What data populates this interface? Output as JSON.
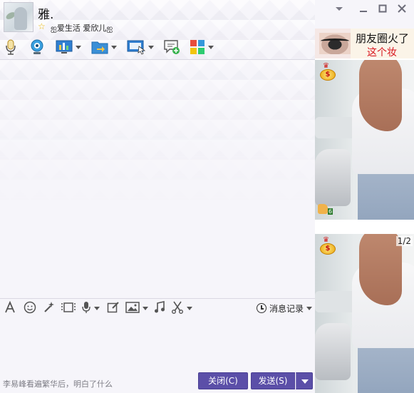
{
  "header": {
    "contact_name": "雅.",
    "signature": "ஐ爱生活 爱欣儿ஐ"
  },
  "input_toolbar": {
    "history_label": "消息记录"
  },
  "bottom": {
    "tip_text": "李易峰看遍繁华后，明白了什么",
    "close_label": "关闭(C)",
    "send_label": "发送(S)"
  },
  "right_panel": {
    "ad_title": "朋友圈火了",
    "ad_subtitle": "这个妆",
    "like_count": "6",
    "page_indicator": "1/2"
  },
  "colors": {
    "button": "#5b4fa8",
    "background": "#f6f5fa",
    "ad_red": "#d8161e"
  },
  "icons": {
    "toolbar": [
      "microphone-icon",
      "video-call-icon",
      "screen-share-icon",
      "file-transfer-icon",
      "remote-desktop-icon",
      "chat-add-icon",
      "apps-icon"
    ],
    "input_toolbar": [
      "font-icon",
      "emoji-icon",
      "magic-icon",
      "video-clip-icon",
      "voice-icon",
      "edit-icon",
      "image-icon",
      "music-icon",
      "screenshot-icon",
      "clock-icon"
    ]
  }
}
